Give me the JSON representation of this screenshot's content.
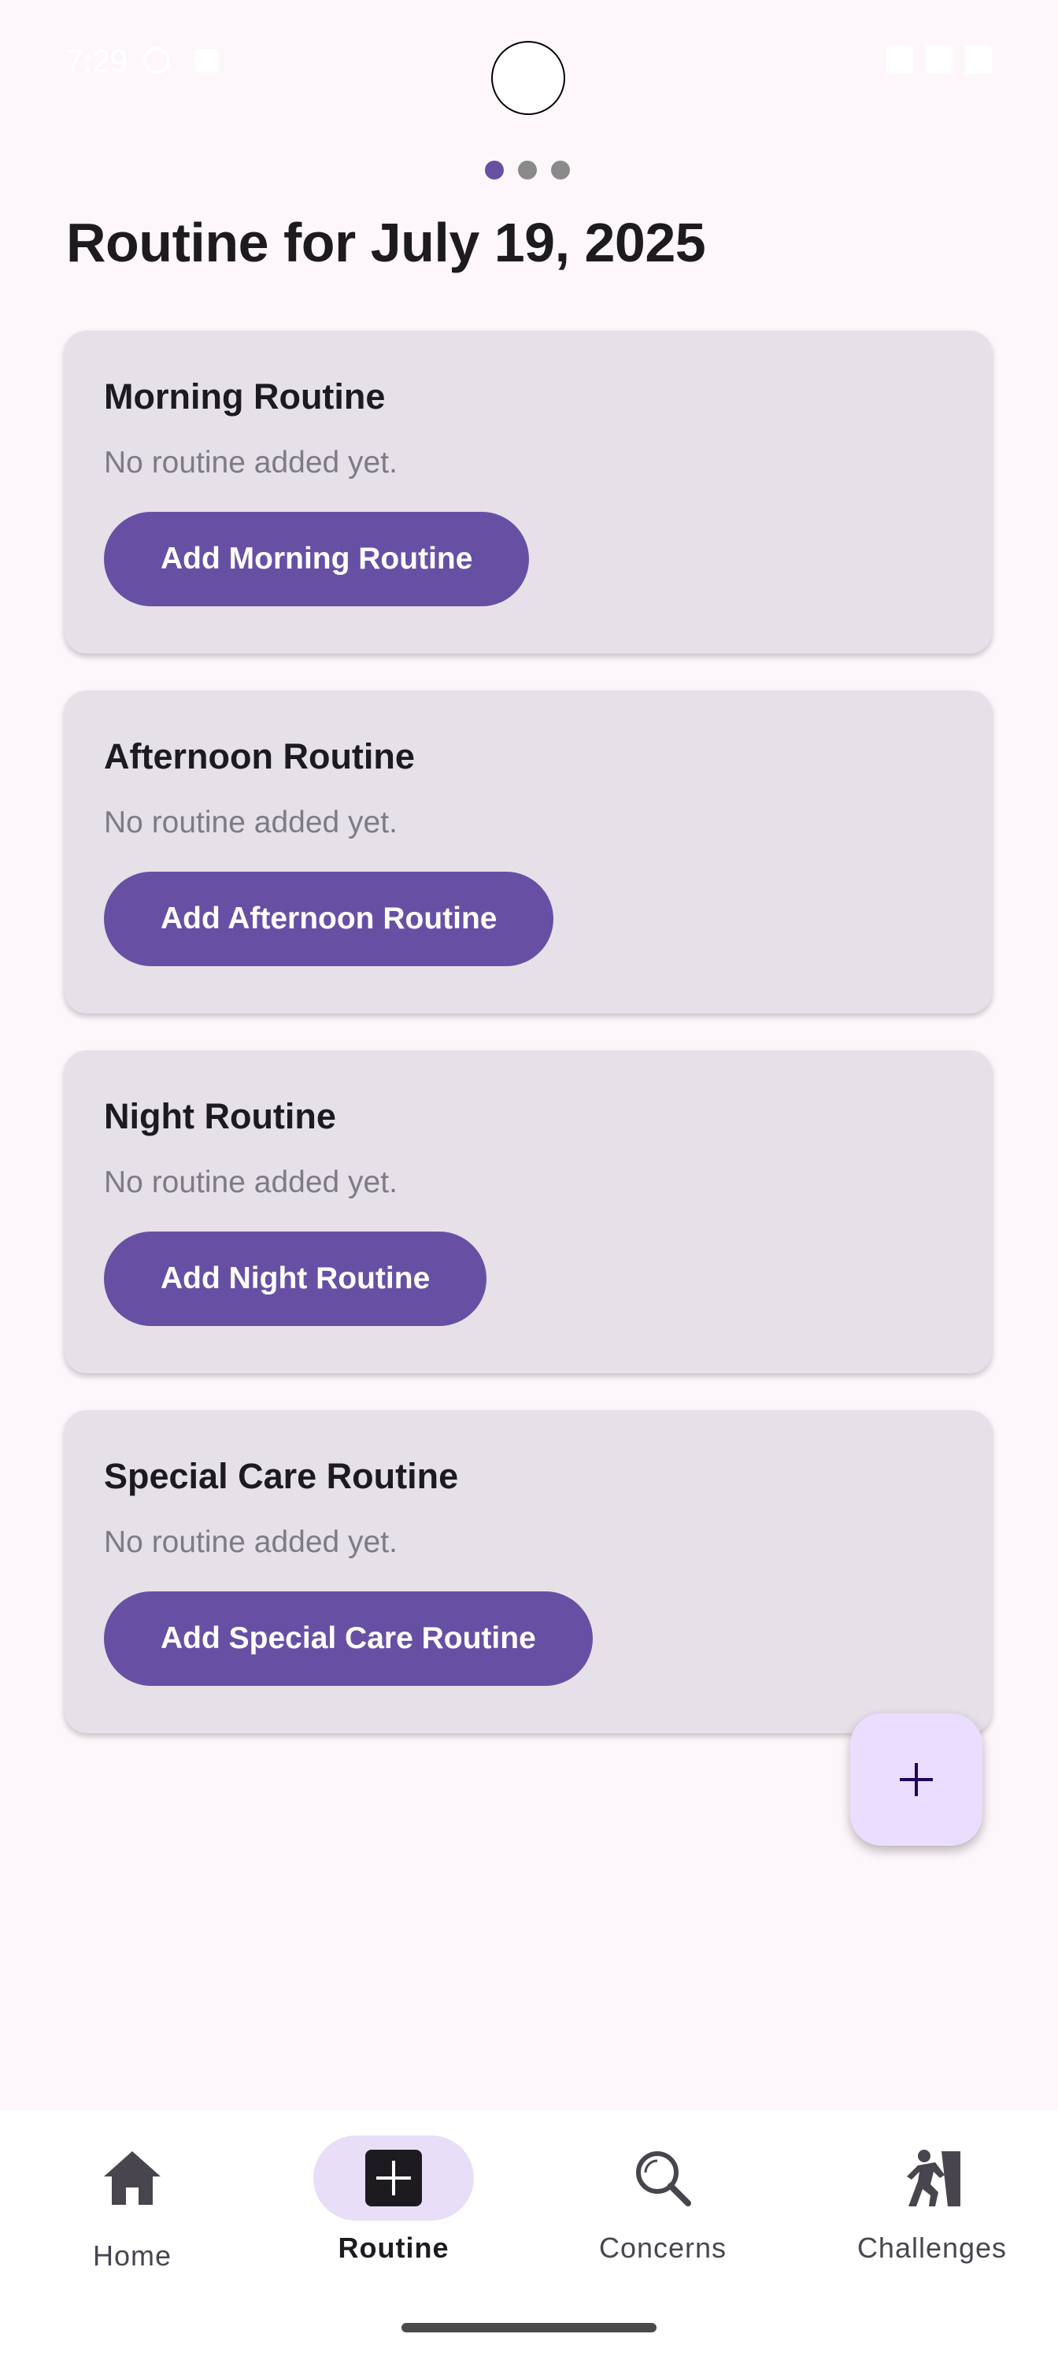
{
  "status_bar": {
    "time": "7:29"
  },
  "pager": {
    "dots": 3,
    "active_index": 0
  },
  "page_title": "Routine for July 19, 2025",
  "routines": [
    {
      "title": "Morning Routine",
      "subtitle": "No routine added yet.",
      "button_label": "Add Morning Routine"
    },
    {
      "title": "Afternoon Routine",
      "subtitle": "No routine added yet.",
      "button_label": "Add Afternoon Routine"
    },
    {
      "title": "Night Routine",
      "subtitle": "No routine added yet.",
      "button_label": "Add Night Routine"
    },
    {
      "title": "Special Care Routine",
      "subtitle": "No routine added yet.",
      "button_label": "Add Special Care Routine"
    }
  ],
  "fab": {
    "icon": "plus-icon"
  },
  "bottom_nav": {
    "items": [
      {
        "label": "Home",
        "icon": "home-icon",
        "selected": false
      },
      {
        "label": "Routine",
        "icon": "add-box-icon",
        "selected": true
      },
      {
        "label": "Concerns",
        "icon": "search-icon",
        "selected": false
      },
      {
        "label": "Challenges",
        "icon": "person-climbing-icon",
        "selected": false
      }
    ]
  },
  "colors": {
    "primary": "#6750a4",
    "background": "#fdf7fc",
    "card": "#e6e0e8",
    "fab": "#eaddff",
    "nav_indicator": "#e8def8"
  }
}
